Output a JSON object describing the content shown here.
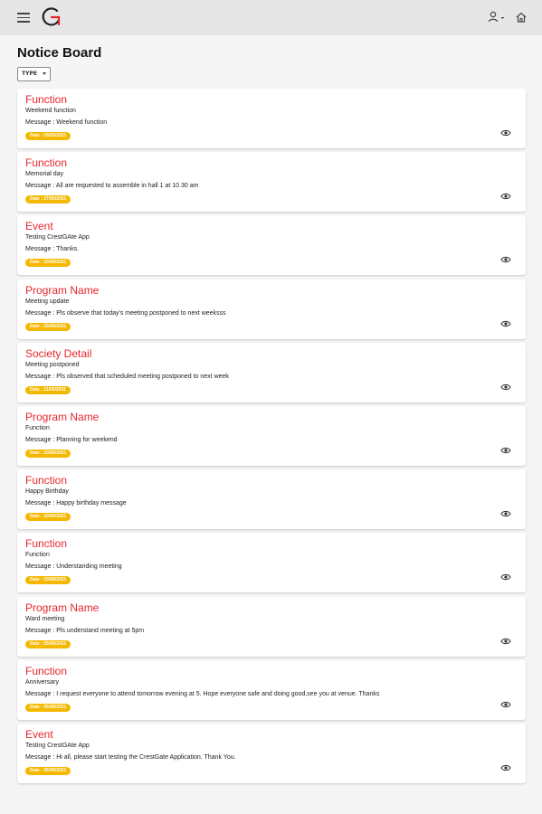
{
  "header": {
    "menu_icon": "hamburger-menu-icon",
    "logo_icon": "crestgate-logo-icon",
    "logo_color": "#e8262c",
    "user_icon": "user-icon",
    "home_icon": "home-icon"
  },
  "page": {
    "title": "Notice Board"
  },
  "filter": {
    "type_label": "TYPE"
  },
  "colors": {
    "accent": "#e8262c",
    "date_badge": "#f5b800",
    "topbar": "#e6e6e6",
    "background": "#f5f5f5"
  },
  "notices": [
    {
      "type": "Function",
      "subject": "Weekend function",
      "message": "Message : Weekend function",
      "date": "Date : 03/05/2021",
      "view_icon": "eye-icon"
    },
    {
      "type": "Function",
      "subject": "Memorial day",
      "message": "Message : All are requested to assemble in hall 1 at 10.30 am",
      "date": "Date : 27/05/2021",
      "view_icon": "eye-icon"
    },
    {
      "type": "Event",
      "subject": "Testing CrestGAte App",
      "message": "Message : Thanks.",
      "date": "Date : 10/06/2021",
      "view_icon": "eye-icon"
    },
    {
      "type": "Program Name",
      "subject": "Meeting update",
      "message": "Message : Pls observe that today's meeting postponed to next weeksss",
      "date": "Date : 25/05/2021",
      "view_icon": "eye-icon"
    },
    {
      "type": "Society Detail",
      "subject": "Meeting postponed",
      "message": "Message : Pls observed that scheduled meeting postponed to next week",
      "date": "Date : 11/05/2021",
      "view_icon": "eye-icon"
    },
    {
      "type": "Program Name",
      "subject": "Function",
      "message": "Message : Planning for weekend",
      "date": "Date : 10/05/2021",
      "view_icon": "eye-icon"
    },
    {
      "type": "Function",
      "subject": "Happy Birthday",
      "message": "Message : Happy birthday message",
      "date": "Date : 10/05/2021",
      "view_icon": "eye-icon"
    },
    {
      "type": "Function",
      "subject": "Function",
      "message": "Message : Understanding meeting",
      "date": "Date : 10/05/2021",
      "view_icon": "eye-icon"
    },
    {
      "type": "Program Name",
      "subject": "Ward meeting",
      "message": "Message : Pls understand meeting at 5pm",
      "date": "Date : 05/05/2021",
      "view_icon": "eye-icon"
    },
    {
      "type": "Function",
      "subject": "Anniversary",
      "message": "Message : I request everyone to attend tomorrow evening at 5. Hope everyone safe and doing good,see you at venue. Thanks",
      "date": "Date : 05/05/2021",
      "view_icon": "eye-icon"
    },
    {
      "type": "Event",
      "subject": "Testing CrestGAte App",
      "message": "Message : Hi all, please start testing the CrestGate Application. Thank You.",
      "date": "Date : 05/05/2021",
      "view_icon": "eye-icon"
    }
  ]
}
